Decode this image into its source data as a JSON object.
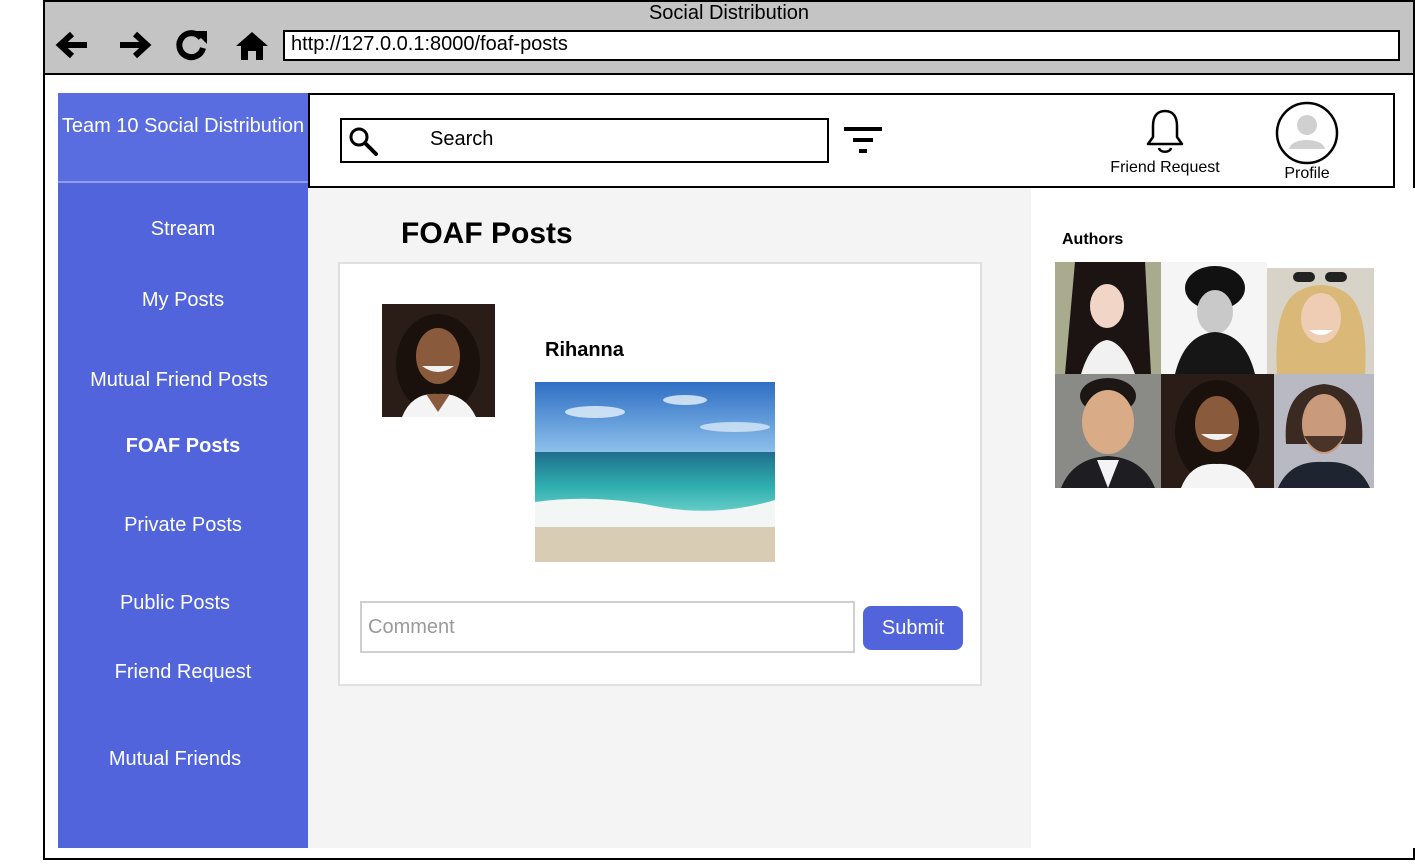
{
  "window": {
    "title": "Social Distribution"
  },
  "toolbar": {
    "back_icon": "arrow-left-icon",
    "forward_icon": "arrow-right-icon",
    "reload_icon": "reload-icon",
    "home_icon": "home-icon",
    "url": "http://127.0.0.1:8000/foaf-posts"
  },
  "sidebar": {
    "brand": "Team 10 Social Distribution",
    "items": [
      {
        "label": "Stream",
        "active": false
      },
      {
        "label": "My Posts",
        "active": false
      },
      {
        "label": "Mutual Friend Posts",
        "active": false
      },
      {
        "label": "FOAF Posts",
        "active": true
      },
      {
        "label": "Private Posts",
        "active": false
      },
      {
        "label": "Public Posts",
        "active": false
      },
      {
        "label": "Friend Request",
        "active": false
      },
      {
        "label": "Mutual Friends",
        "active": false
      }
    ]
  },
  "header": {
    "search_placeholder": "Search",
    "filter_icon": "filter-icon",
    "friend_request_label": "Friend Request",
    "profile_label": "Profile"
  },
  "main": {
    "title": "FOAF Posts",
    "post": {
      "author": "Rihanna",
      "comment_placeholder": "Comment",
      "submit_label": "Submit"
    }
  },
  "authors": {
    "title": "Authors",
    "count": 6
  },
  "colors": {
    "sidebar": "#5164db",
    "brand": "#5a6de0",
    "chrome": "#c4c4c4",
    "main_bg": "#f4f4f4",
    "button": "#5164db"
  }
}
